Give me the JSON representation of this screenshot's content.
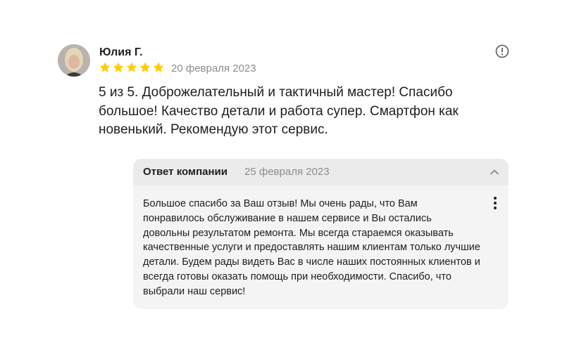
{
  "review": {
    "author": "Юлия Г.",
    "rating": 5,
    "max_rating": 5,
    "date": "20 февраля 2023",
    "text": "5 из 5. Доброжелательный и тактичный мастер! Спасибо большое! Качество детали и работа супер. Смартфон как новенький. Рекомендую этот сервис.",
    "star_color": "#ffcc00"
  },
  "reply": {
    "title": "Ответ компании",
    "date": "25 февраля 2023",
    "text": "Большое спасибо за Ваш отзыв! Мы очень рады, что Вам понравилось обслуживание в нашем сервисе и Вы остались довольны результатом ремонта. Мы всегда стараемся оказывать качественные услуги и предоставлять нашим клиентам только лучшие детали. Будем рады видеть Вас в числе наших постоянных клиентов и всегда готовы оказать помощь при необходимости. Спасибо, что выбрали наш сервис!"
  },
  "icons": {
    "report": "exclamation-circle-icon",
    "collapse": "chevron-up-icon",
    "more": "more-vertical-icon",
    "star": "star-icon"
  }
}
